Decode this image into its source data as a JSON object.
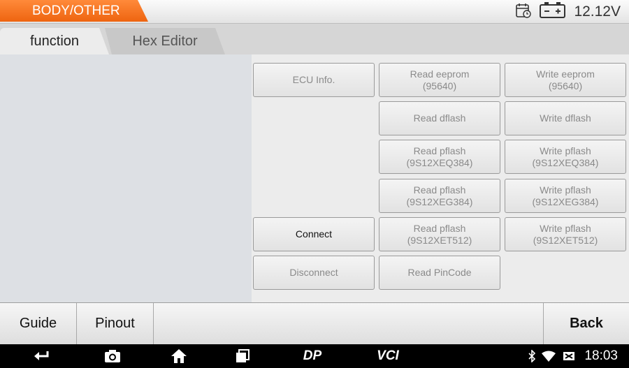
{
  "header": {
    "title": "BODY/OTHER",
    "voltage": "12.12V",
    "accent_color": "#f26b1d"
  },
  "tabs": [
    {
      "label": "function",
      "active": true
    },
    {
      "label": "Hex Editor",
      "active": false
    }
  ],
  "functions": {
    "ecu_info": {
      "line1": "ECU Info.",
      "line2": "",
      "enabled": false
    },
    "read_eeprom": {
      "line1": "Read eeprom",
      "line2": "(95640)",
      "enabled": false
    },
    "write_eeprom": {
      "line1": "Write eeprom",
      "line2": "(95640)",
      "enabled": false
    },
    "read_dflash": {
      "line1": "Read dflash",
      "line2": "",
      "enabled": false
    },
    "write_dflash": {
      "line1": "Write dflash",
      "line2": "",
      "enabled": false
    },
    "read_pflash_xeq": {
      "line1": "Read pflash",
      "line2": "(9S12XEQ384)",
      "enabled": false
    },
    "write_pflash_xeq": {
      "line1": "Write pflash",
      "line2": "(9S12XEQ384)",
      "enabled": false
    },
    "read_pflash_xeg": {
      "line1": "Read pflash",
      "line2": "(9S12XEG384)",
      "enabled": false
    },
    "write_pflash_xeg": {
      "line1": "Write pflash",
      "line2": "(9S12XEG384)",
      "enabled": false
    },
    "connect": {
      "line1": "Connect",
      "line2": "",
      "enabled": true
    },
    "read_pflash_xet": {
      "line1": "Read pflash",
      "line2": "(9S12XET512)",
      "enabled": false
    },
    "write_pflash_xet": {
      "line1": "Write pflash",
      "line2": "(9S12XET512)",
      "enabled": false
    },
    "disconnect": {
      "line1": "Disconnect",
      "line2": "",
      "enabled": false
    },
    "read_pincode": {
      "line1": "Read PinCode",
      "line2": "",
      "enabled": false
    }
  },
  "bottom": {
    "guide": "Guide",
    "pinout": "Pinout",
    "back": "Back"
  },
  "navbar": {
    "icons": [
      "back-arrow-icon",
      "camera-icon",
      "home-icon",
      "recent-apps-icon",
      "dp-icon",
      "vci-icon"
    ],
    "dp_text": "DP",
    "vci_text": "VCI",
    "status_icons": [
      "bluetooth-icon",
      "wifi-icon",
      "sim-off-icon"
    ],
    "time": "18:03"
  }
}
